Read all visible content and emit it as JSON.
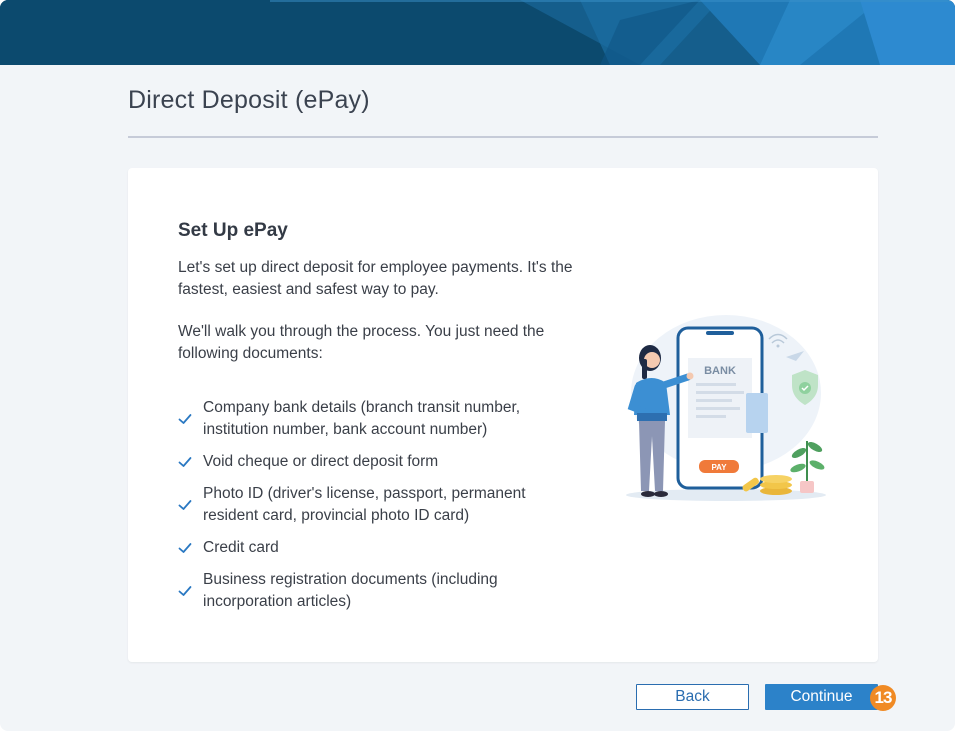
{
  "page": {
    "title": "Direct Deposit (ePay)"
  },
  "card": {
    "heading": "Set Up ePay",
    "intro": "Let's set up direct deposit for employee payments. It's the fastest, easiest and safest way to pay.",
    "instructions": "We'll walk you through the process. You just need the following documents:",
    "documents": [
      "Company bank details (branch transit number, institution number, bank account number)",
      "Void cheque or direct deposit form",
      "Photo ID (driver's license, passport, permanent resident card, provincial photo ID card)",
      "Credit card",
      "Business registration documents (including incorporation articles)"
    ]
  },
  "illustration": {
    "bank_label": "BANK",
    "pay_label": "PAY"
  },
  "footer": {
    "back_label": "Back",
    "continue_label": "Continue",
    "step_badge": "13"
  },
  "colors": {
    "banner": "#0c4a6e",
    "accent": "#2c82c9",
    "badge": "#f08a24",
    "check": "#2a78c2"
  },
  "icons": {
    "list_bullet": "check-icon"
  }
}
